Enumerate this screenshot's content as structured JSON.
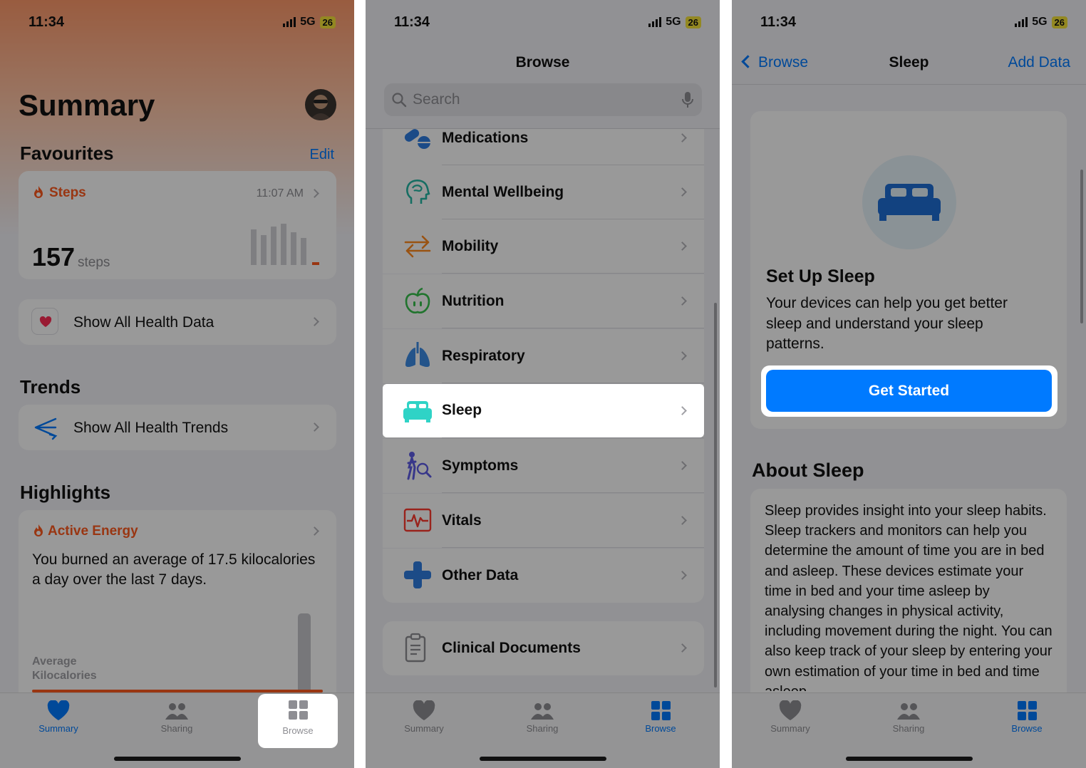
{
  "status_bar": {
    "time": "11:34",
    "network": "5G",
    "battery": "26"
  },
  "panel1": {
    "title": "Summary",
    "favourites": {
      "heading": "Favourites",
      "edit_label": "Edit"
    },
    "steps_card": {
      "label": "Steps",
      "time": "11:07 AM",
      "value": "157",
      "unit": "steps",
      "icon": "flame-icon"
    },
    "show_all_data": "Show All Health Data",
    "trends": {
      "heading": "Trends",
      "show_all_label": "Show All Health Trends"
    },
    "highlights": {
      "heading": "Highlights",
      "card_label": "Active Energy",
      "text": "You burned an average of 17.5 kilocalories a day over the last 7 days.",
      "chart_label_line1": "Average",
      "chart_label_line2": "Kilocalories"
    }
  },
  "panel2": {
    "title": "Browse",
    "search_placeholder": "Search",
    "categories": [
      {
        "label": "Medications",
        "icon": "pills-icon"
      },
      {
        "label": "Mental Wellbeing",
        "icon": "head-icon"
      },
      {
        "label": "Mobility",
        "icon": "arrows-icon"
      },
      {
        "label": "Nutrition",
        "icon": "apple-icon"
      },
      {
        "label": "Respiratory",
        "icon": "lungs-icon"
      },
      {
        "label": "Sleep",
        "icon": "bed-icon"
      },
      {
        "label": "Symptoms",
        "icon": "person-magnifier-icon"
      },
      {
        "label": "Vitals",
        "icon": "heartbeat-icon"
      },
      {
        "label": "Other Data",
        "icon": "plus-icon"
      }
    ],
    "clinical": "Clinical Documents"
  },
  "panel3": {
    "back_label": "Browse",
    "title": "Sleep",
    "add_data": "Add Data",
    "setup": {
      "heading": "Set Up Sleep",
      "text": "Your devices can help you get better sleep and understand your sleep patterns.",
      "button": "Get Started"
    },
    "about": {
      "heading": "About Sleep",
      "text": "Sleep provides insight into your sleep habits. Sleep trackers and monitors can help you determine the amount of time you are in bed and asleep. These devices estimate your time in bed and your time asleep by analysing changes in physical activity, including movement during the night. You can also keep track of your sleep by entering your own estimation of your time in bed and time asleep."
    }
  },
  "tabs": [
    {
      "label": "Summary",
      "icon": "heart-icon"
    },
    {
      "label": "Sharing",
      "icon": "people-icon"
    },
    {
      "label": "Browse",
      "icon": "grid-icon"
    }
  ],
  "colors": {
    "accent": "#007aff",
    "orange": "#ff5a1f",
    "sleep": "#2fd3c6"
  }
}
